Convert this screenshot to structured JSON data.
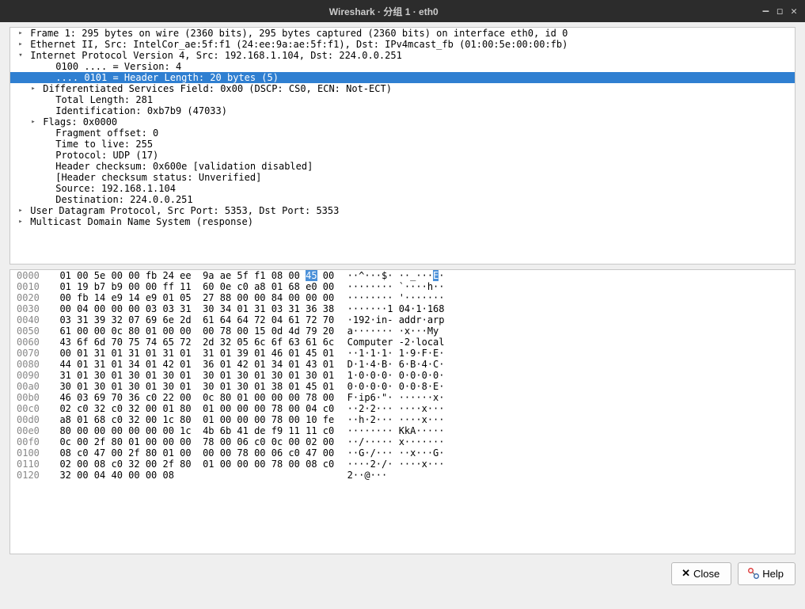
{
  "window": {
    "title": "Wireshark · 分组 1 · eth0"
  },
  "buttons": {
    "close": "Close",
    "help": "Help"
  },
  "tree": [
    {
      "arrow": "right",
      "indent": 0,
      "sel": false,
      "text": "Frame 1: 295 bytes on wire (2360 bits), 295 bytes captured (2360 bits) on interface eth0, id 0"
    },
    {
      "arrow": "right",
      "indent": 0,
      "sel": false,
      "text": "Ethernet II, Src: IntelCor_ae:5f:f1 (24:ee:9a:ae:5f:f1), Dst: IPv4mcast_fb (01:00:5e:00:00:fb)"
    },
    {
      "arrow": "down",
      "indent": 0,
      "sel": false,
      "text": "Internet Protocol Version 4, Src: 192.168.1.104, Dst: 224.0.0.251"
    },
    {
      "arrow": "",
      "indent": 2,
      "sel": false,
      "text": "0100 .... = Version: 4"
    },
    {
      "arrow": "",
      "indent": 2,
      "sel": true,
      "text": ".... 0101 = Header Length: 20 bytes (5)"
    },
    {
      "arrow": "right",
      "indent": 1,
      "sel": false,
      "text": "Differentiated Services Field: 0x00 (DSCP: CS0, ECN: Not-ECT)"
    },
    {
      "arrow": "",
      "indent": 2,
      "sel": false,
      "text": "Total Length: 281"
    },
    {
      "arrow": "",
      "indent": 2,
      "sel": false,
      "text": "Identification: 0xb7b9 (47033)"
    },
    {
      "arrow": "right",
      "indent": 1,
      "sel": false,
      "text": "Flags: 0x0000"
    },
    {
      "arrow": "",
      "indent": 2,
      "sel": false,
      "text": "Fragment offset: 0"
    },
    {
      "arrow": "",
      "indent": 2,
      "sel": false,
      "text": "Time to live: 255"
    },
    {
      "arrow": "",
      "indent": 2,
      "sel": false,
      "text": "Protocol: UDP (17)"
    },
    {
      "arrow": "",
      "indent": 2,
      "sel": false,
      "text": "Header checksum: 0x600e [validation disabled]"
    },
    {
      "arrow": "",
      "indent": 2,
      "sel": false,
      "text": "[Header checksum status: Unverified]"
    },
    {
      "arrow": "",
      "indent": 2,
      "sel": false,
      "text": "Source: 192.168.1.104"
    },
    {
      "arrow": "",
      "indent": 2,
      "sel": false,
      "text": "Destination: 224.0.0.251"
    },
    {
      "arrow": "right",
      "indent": 0,
      "sel": false,
      "text": "User Datagram Protocol, Src Port: 5353, Dst Port: 5353"
    },
    {
      "arrow": "right",
      "indent": 0,
      "sel": false,
      "text": "Multicast Domain Name System (response)"
    }
  ],
  "hex": [
    {
      "off": "0000",
      "h1": "01 00 5e 00 00 fb 24 ee",
      "h2": "9a ae 5f f1 08 00 ",
      "hl": "45",
      "h3": " 00",
      "a": "··^···$· ··_···",
      "ahl": "E",
      "a2": "·"
    },
    {
      "off": "0010",
      "h": "01 19 b7 b9 00 00 ff 11  60 0e c0 a8 01 68 e0 00",
      "a": "········ `····h··"
    },
    {
      "off": "0020",
      "h": "00 fb 14 e9 14 e9 01 05  27 88 00 00 84 00 00 00",
      "a": "········ '·······"
    },
    {
      "off": "0030",
      "h": "00 04 00 00 00 03 03 31  30 34 01 31 03 31 36 38",
      "a": "·······1 04·1·168"
    },
    {
      "off": "0040",
      "h": "03 31 39 32 07 69 6e 2d  61 64 64 72 04 61 72 70",
      "a": "·192·in- addr·arp"
    },
    {
      "off": "0050",
      "h": "61 00 00 0c 80 01 00 00  00 78 00 15 0d 4d 79 20",
      "a": "a······· ·x···My "
    },
    {
      "off": "0060",
      "h": "43 6f 6d 70 75 74 65 72  2d 32 05 6c 6f 63 61 6c",
      "a": "Computer -2·local"
    },
    {
      "off": "0070",
      "h": "00 01 31 01 31 01 31 01  31 01 39 01 46 01 45 01",
      "a": "··1·1·1· 1·9·F·E·"
    },
    {
      "off": "0080",
      "h": "44 01 31 01 34 01 42 01  36 01 42 01 34 01 43 01",
      "a": "D·1·4·B· 6·B·4·C·"
    },
    {
      "off": "0090",
      "h": "31 01 30 01 30 01 30 01  30 01 30 01 30 01 30 01",
      "a": "1·0·0·0· 0·0·0·0·"
    },
    {
      "off": "00a0",
      "h": "30 01 30 01 30 01 30 01  30 01 30 01 38 01 45 01",
      "a": "0·0·0·0· 0·0·8·E·"
    },
    {
      "off": "00b0",
      "h": "46 03 69 70 36 c0 22 00  0c 80 01 00 00 00 78 00",
      "a": "F·ip6·\"· ······x·"
    },
    {
      "off": "00c0",
      "h": "02 c0 32 c0 32 00 01 80  01 00 00 00 78 00 04 c0",
      "a": "··2·2··· ····x···"
    },
    {
      "off": "00d0",
      "h": "a8 01 68 c0 32 00 1c 80  01 00 00 00 78 00 10 fe",
      "a": "··h·2··· ····x···"
    },
    {
      "off": "00e0",
      "h": "80 00 00 00 00 00 00 1c  4b 6b 41 de f9 11 11 c0",
      "a": "········ KkA·····"
    },
    {
      "off": "00f0",
      "h": "0c 00 2f 80 01 00 00 00  78 00 06 c0 0c 00 02 00",
      "a": "··/····· x·······"
    },
    {
      "off": "0100",
      "h": "08 c0 47 00 2f 80 01 00  00 00 78 00 06 c0 47 00",
      "a": "··G·/··· ··x···G·"
    },
    {
      "off": "0110",
      "h": "02 00 08 c0 32 00 2f 80  01 00 00 00 78 00 08 c0",
      "a": "····2·/· ····x···"
    },
    {
      "off": "0120",
      "h": "32 00 04 40 00 00 08",
      "a": "2··@···"
    }
  ]
}
